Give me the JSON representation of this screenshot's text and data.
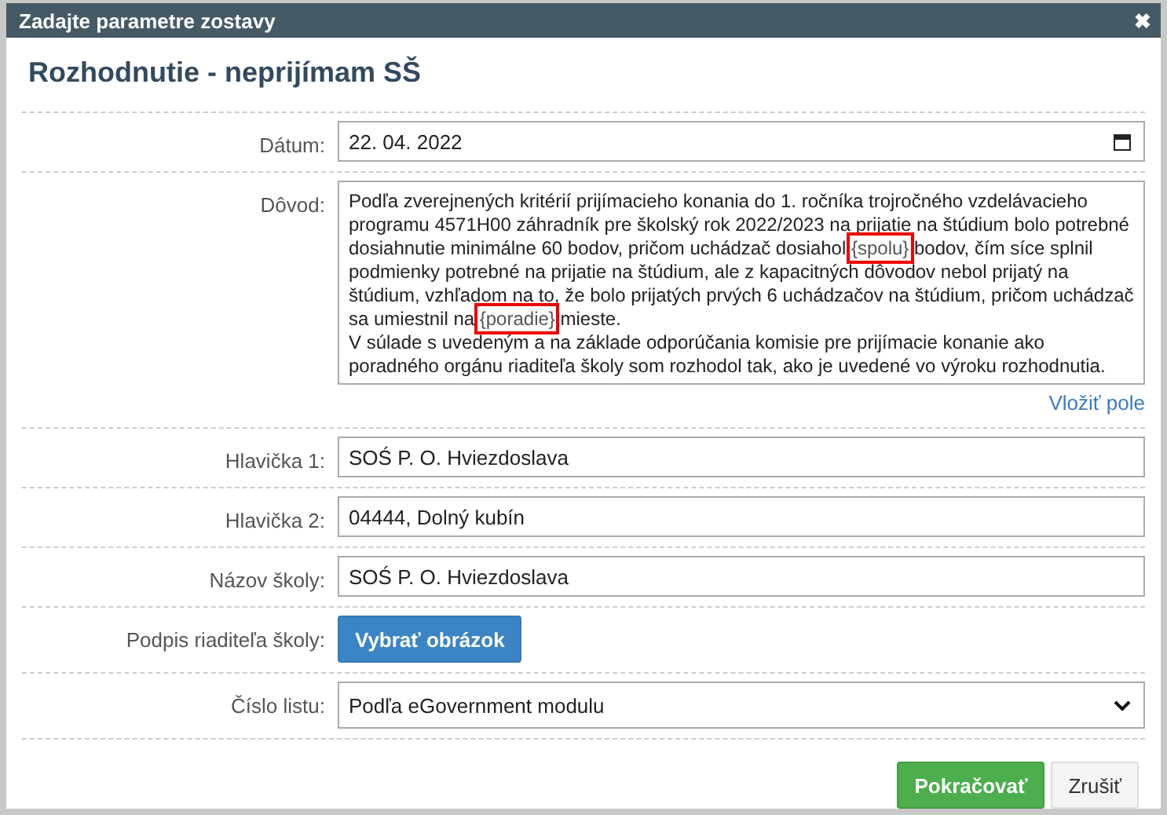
{
  "window": {
    "title": "Zadajte parametre zostavy",
    "close": "✖"
  },
  "heading": "Rozhodnutie - neprijímam SŠ",
  "fields": [
    {
      "kind": "date",
      "label": "Dátum:",
      "value": "22. 04. 2022"
    },
    {
      "kind": "textarea",
      "label": "Dôvod:",
      "paragraphs": [
        [
          {
            "text": "Podľa zverejnených kritérií prijímacieho konania do 1. ročníka trojročného vzdelávacieho programu 4571H00 záhradník pre školský rok 2022/2023 na prijatie na štúdium bolo potrebné dosiahnutie minimálne 60 bodov, pričom uchádzač dosiahol ",
            "highlighted": false
          },
          {
            "text": "{spolu}",
            "highlighted": true
          },
          {
            "text": " bodov, čím síce splnil podmienky potrebné na prijatie na štúdium, ale z kapacitných dôvodov nebol prijatý na štúdium, vzhľadom na to, že bolo prijatých prvých 6 uchádzačov na štúdium, pričom uchádzač sa umiestnil na ",
            "highlighted": false
          },
          {
            "text": "{poradie}",
            "highlighted": true
          },
          {
            "text": " mieste.",
            "highlighted": false
          }
        ],
        [
          {
            "text": "V súlade s uvedeným a na základe odporúčania komisie pre prijímacie konanie ako poradného orgánu riaditeľa školy som rozhodol tak, ako je uvedené vo výroku rozhodnutia.",
            "highlighted": false
          }
        ]
      ],
      "link": "Vložiť pole"
    },
    {
      "kind": "text",
      "label": "Hlavička 1:",
      "value": "SOŚ P. O. Hviezdoslava"
    },
    {
      "kind": "text",
      "label": "Hlavička 2:",
      "value": "04444, Dolný kubín"
    },
    {
      "kind": "text",
      "label": "Názov školy:",
      "value": "SOŚ P. O. Hviezdoslava"
    },
    {
      "kind": "button",
      "label": "Podpis riaditeľa školy:",
      "button": "Vybrať obrázok"
    },
    {
      "kind": "select",
      "label": "Číslo listu:",
      "value": "Podľa eGovernment modulu"
    }
  ],
  "buttons": [
    {
      "label": "Pokračovať",
      "kind": "primary"
    },
    {
      "label": "Zrušiť",
      "kind": "default"
    }
  ]
}
